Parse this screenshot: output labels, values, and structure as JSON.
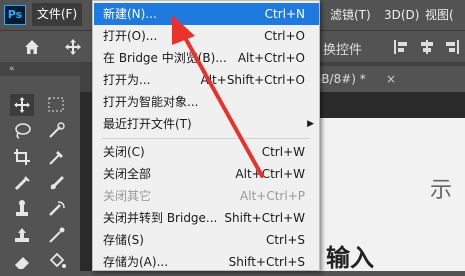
{
  "app": {
    "logo_text": "Ps",
    "accent": "#1f7ae0"
  },
  "menubar": {
    "file_label": "文件(F)",
    "right_items": [
      "滤镜(T)",
      "3D(D)",
      "视图("
    ]
  },
  "optionsbar": {
    "convert_label": "换控件"
  },
  "document": {
    "tab_label": "GB/8#) *",
    "close_glyph": "×",
    "paper_text_1": "示",
    "paper_text_2": "输入"
  },
  "panel": {
    "collapse_glyph": "«"
  },
  "file_menu": {
    "items": [
      {
        "label": "新建(N)...",
        "shortcut": "Ctrl+N",
        "highlighted": true
      },
      {
        "label": "打开(O)...",
        "shortcut": "Ctrl+O"
      },
      {
        "label": "在 Bridge 中浏览(B)...",
        "shortcut": "Alt+Ctrl+O"
      },
      {
        "label": "打开为...",
        "shortcut": "Alt+Shift+Ctrl+O"
      },
      {
        "label": "打开为智能对象..."
      },
      {
        "label": "最近打开文件(T)",
        "submenu": true,
        "submenu_glyph": "▶"
      },
      {
        "label": "关闭(C)",
        "shortcut": "Ctrl+W"
      },
      {
        "label": "关闭全部",
        "shortcut": "Alt+Ctrl+W"
      },
      {
        "label": "关闭其它",
        "shortcut": "Alt+Ctrl+P",
        "disabled": true
      },
      {
        "label": "关闭并转到 Bridge...",
        "shortcut": "Shift+Ctrl+W"
      },
      {
        "label": "存储(S)",
        "shortcut": "Ctrl+S"
      },
      {
        "label": "存储为(A)...",
        "shortcut": "Shift+Ctrl+S"
      }
    ]
  },
  "annotation": {
    "arrow_color": "#e8322c"
  }
}
